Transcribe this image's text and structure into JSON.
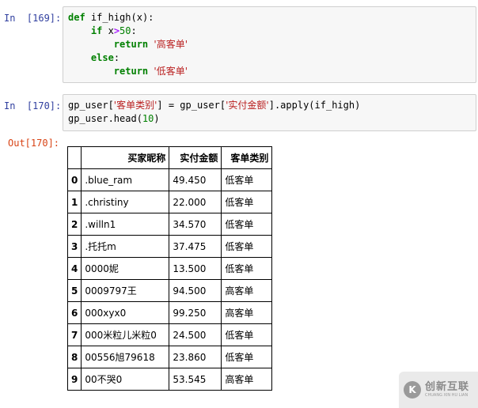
{
  "cells": [
    {
      "prompt": "In  [169]:",
      "code_lines": [
        [
          "def",
          " ",
          "if_high",
          "(x):"
        ],
        [
          "if",
          " x",
          ">",
          "50",
          ":"
        ],
        [
          "return",
          " ",
          "'高客单'"
        ],
        [
          "else",
          ":"
        ],
        [
          "return",
          " ",
          "'低客单'"
        ]
      ]
    },
    {
      "prompt": "In  [170]:",
      "code_lines": [
        [
          "gp_user[",
          "'客单类别'",
          "] = gp_user[",
          "'实付金额'",
          "].apply(if_high)"
        ],
        [
          "gp_user.head(",
          "10",
          ")"
        ]
      ]
    }
  ],
  "output_prompt": "Out[170]:",
  "table": {
    "columns": [
      "买家昵称",
      "实付金额",
      "客单类别"
    ],
    "rows": [
      {
        "index": "0",
        "name": ".blue_ram",
        "amount": "49.450",
        "type": "低客单"
      },
      {
        "index": "1",
        "name": ".christiny",
        "amount": "22.000",
        "type": "低客单"
      },
      {
        "index": "2",
        "name": ".willn1",
        "amount": "34.570",
        "type": "低客单"
      },
      {
        "index": "3",
        "name": ".托托m",
        "amount": "37.475",
        "type": "低客单"
      },
      {
        "index": "4",
        "name": "0000妮",
        "amount": "13.500",
        "type": "低客单"
      },
      {
        "index": "5",
        "name": "0009797王",
        "amount": "94.500",
        "type": "高客单"
      },
      {
        "index": "6",
        "name": "000xyx0",
        "amount": "99.250",
        "type": "高客单"
      },
      {
        "index": "7",
        "name": "000米粒儿米粒0",
        "amount": "24.500",
        "type": "低客单"
      },
      {
        "index": "8",
        "name": "00556旭79618",
        "amount": "23.860",
        "type": "低客单"
      },
      {
        "index": "9",
        "name": "00不哭0",
        "amount": "53.545",
        "type": "高客单"
      }
    ]
  },
  "watermark": {
    "logo_letter": "K",
    "text_cn": "创新互联",
    "text_en": "CHUANG XIN HU LIAN"
  },
  "colors": {
    "in_prompt": "#303f9f",
    "out_prompt": "#d84315",
    "keyword": "#008000",
    "string": "#ba2121",
    "operator": "#aa22ff",
    "cell_background": "#f7f7f7"
  }
}
